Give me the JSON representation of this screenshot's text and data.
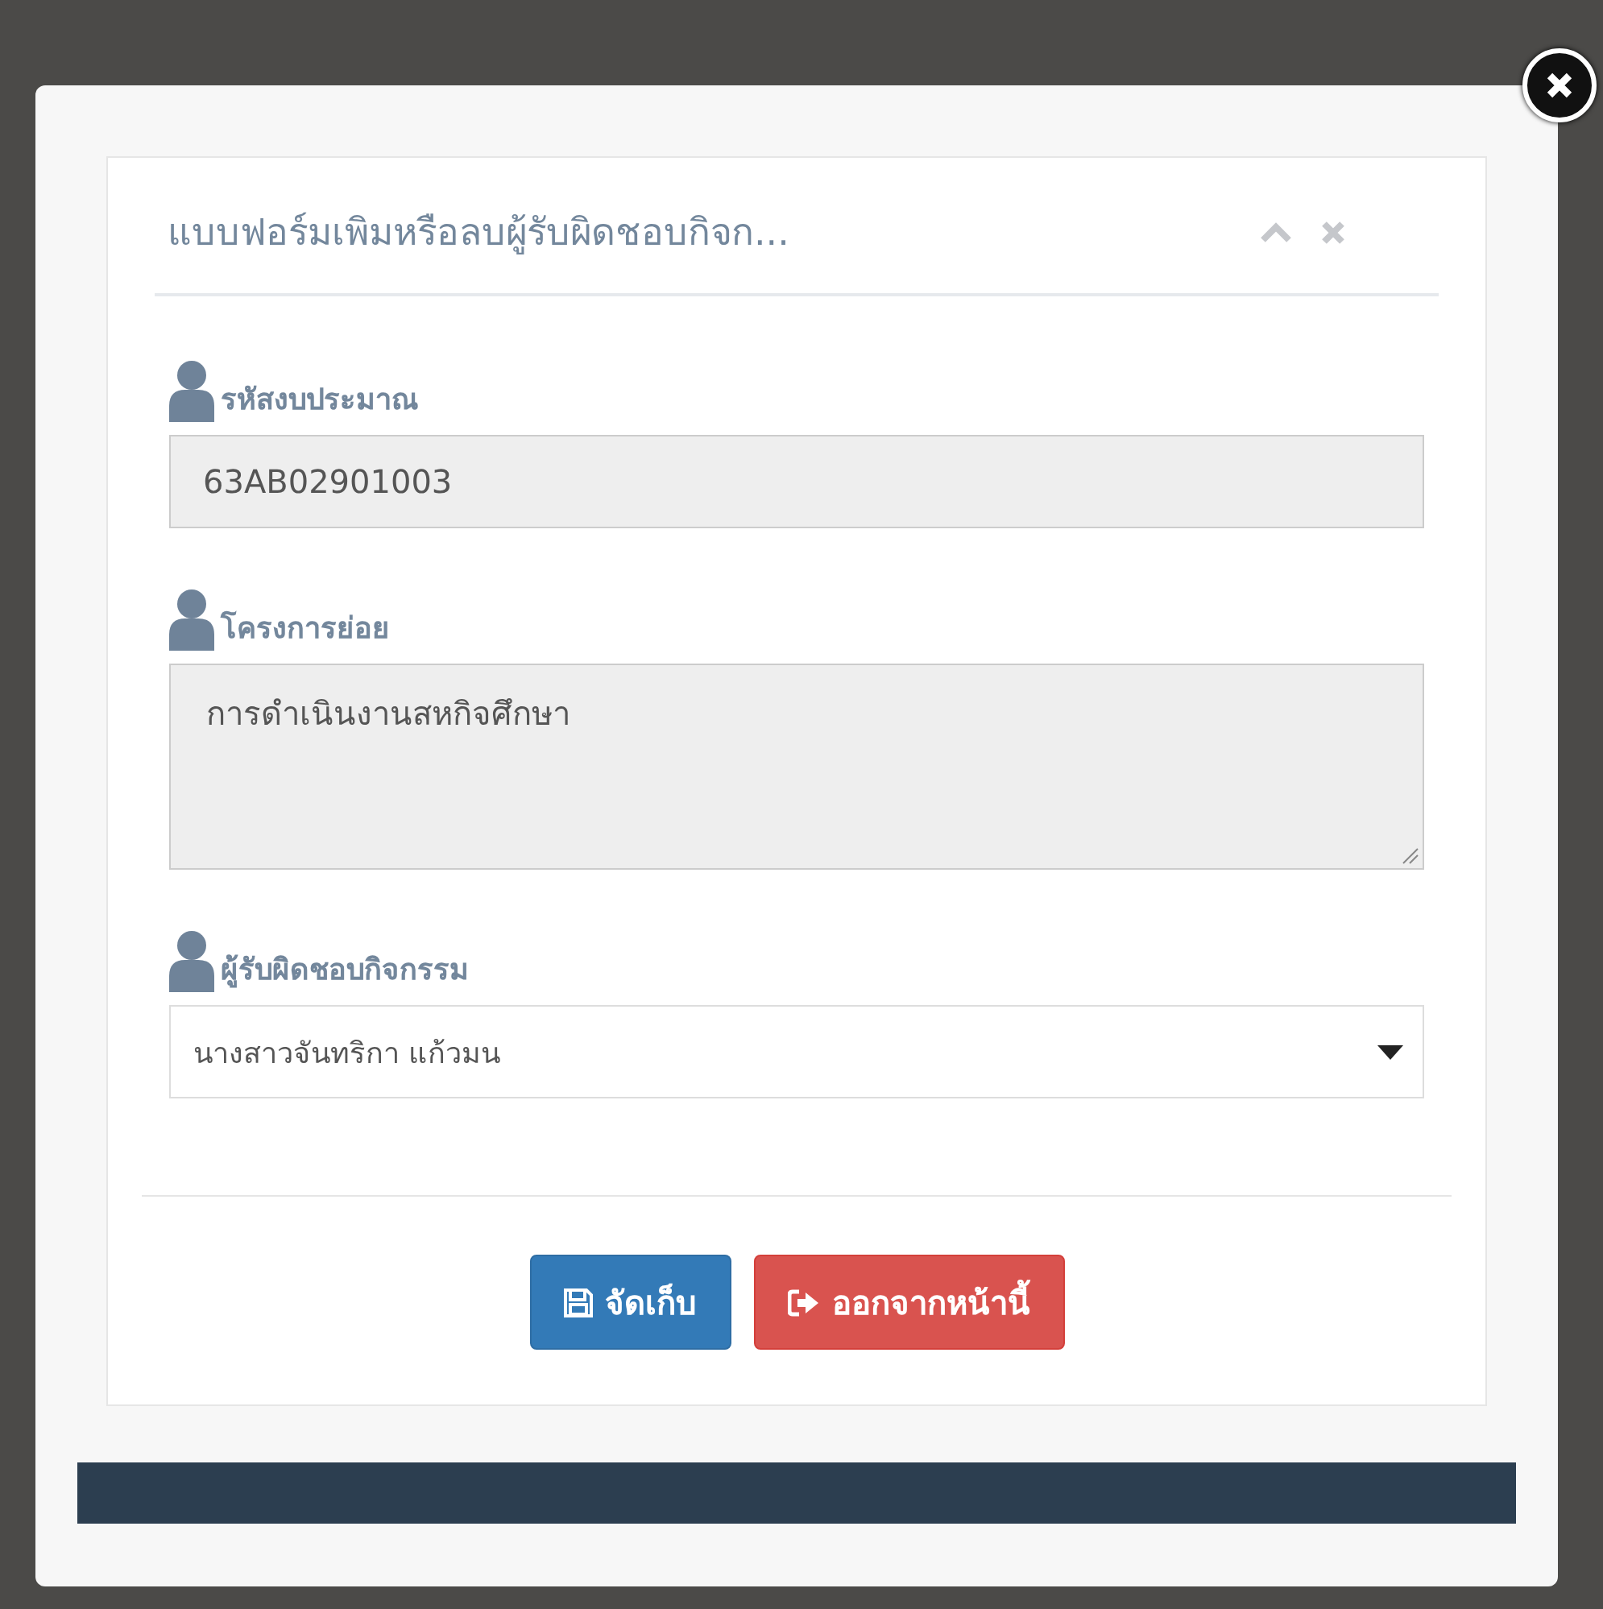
{
  "panel": {
    "title": "แบบฟอร์มเพิมหรือลบผู้รับผิดชอบกิจก..."
  },
  "fields": [
    {
      "kind": "input",
      "label": "รหัสงบประมาณ",
      "value": "63AB02901003"
    },
    {
      "kind": "textarea",
      "label": "โครงการย่อย",
      "value": "การดำเนินงานสหกิจศึกษา"
    },
    {
      "kind": "select",
      "label": "ผู้รับผิดชอบกิจกรรม",
      "value": "นางสาวจันทริกา แก้วมน"
    }
  ],
  "buttons": [
    {
      "kind": "save",
      "label": "จัดเก็บ"
    },
    {
      "kind": "exit",
      "label": "ออกจากหน้านี้"
    }
  ]
}
